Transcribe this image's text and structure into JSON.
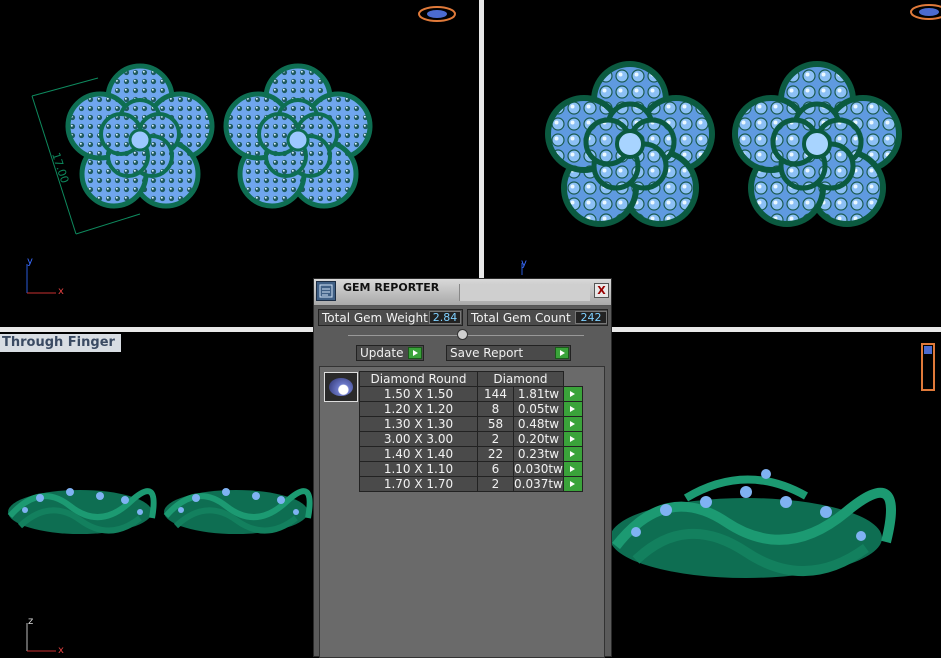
{
  "viewport_labels": {
    "bottom_left": "Through Finger"
  },
  "dimension_label": "17.00",
  "axes": {
    "top_left": {
      "v": "y",
      "h": "x"
    },
    "top_right": {
      "v": "y"
    },
    "bottom_left": {
      "v": "z",
      "h": "x"
    }
  },
  "gem_reporter": {
    "title": "GEM REPORTER",
    "close_label": "X",
    "total_weight_label": "Total Gem Weight",
    "total_weight_value": "2.84",
    "total_count_label": "Total Gem Count",
    "total_count_value": "242",
    "update_label": "Update",
    "save_report_label": "Save Report",
    "table": {
      "col_shape": "Diamond Round",
      "col_material": "Diamond",
      "rows": [
        {
          "size": "1.50 X 1.50",
          "count": "144",
          "weight": "1.81tw"
        },
        {
          "size": "1.20 X 1.20",
          "count": "8",
          "weight": "0.05tw"
        },
        {
          "size": "1.30 X 1.30",
          "count": "58",
          "weight": "0.48tw"
        },
        {
          "size": "3.00 X 3.00",
          "count": "2",
          "weight": "0.20tw"
        },
        {
          "size": "1.40 X 1.40",
          "count": "22",
          "weight": "0.23tw"
        },
        {
          "size": "1.10 X 1.10",
          "count": "6",
          "weight": "0.030tw"
        },
        {
          "size": "1.70 X 1.70",
          "count": "2",
          "weight": "0.037tw"
        }
      ]
    }
  },
  "colors": {
    "metal": "#0e6e52",
    "gem": "#7fb2f2",
    "gem_highlight": "#d8f0ff",
    "accent_button": "#3aa33a",
    "value_text": "#7fd0ff"
  }
}
